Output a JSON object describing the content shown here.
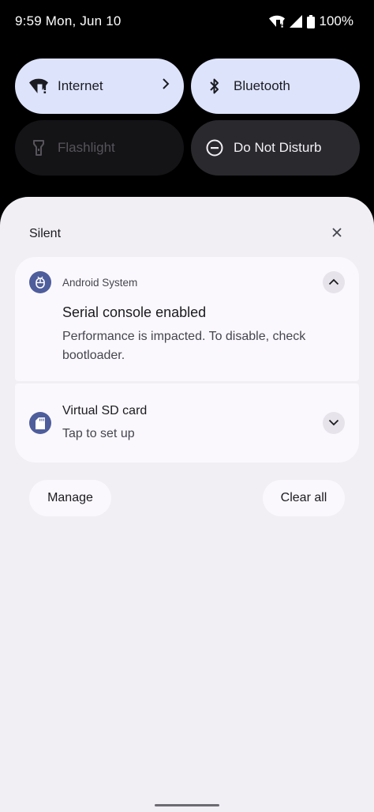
{
  "status_bar": {
    "time": "9:59 Mon, Jun 10",
    "battery": "100%"
  },
  "quick_settings": {
    "internet": {
      "label": "Internet",
      "icon": "wifi-alert-icon",
      "state": "on"
    },
    "bluetooth": {
      "label": "Bluetooth",
      "icon": "bluetooth-icon",
      "state": "on"
    },
    "flashlight": {
      "label": "Flashlight",
      "icon": "flashlight-icon",
      "state": "unavailable"
    },
    "dnd": {
      "label": "Do Not Disturb",
      "icon": "do-not-disturb-icon",
      "state": "off"
    }
  },
  "notifications": {
    "section_title": "Silent",
    "items": [
      {
        "app": "Android System",
        "title": "Serial console enabled",
        "text": "Performance is impacted. To disable, check bootloader.",
        "icon": "bug-icon",
        "expanded": true
      },
      {
        "title": "Virtual SD card",
        "text": "Tap to set up",
        "icon": "sd-card-icon",
        "expanded": false
      }
    ],
    "manage_label": "Manage",
    "clear_all_label": "Clear all"
  },
  "colors": {
    "tile_on": "#dde3fb",
    "tile_off": "#2a292d",
    "shade_bg": "#f1eff4",
    "card_bg": "#fbf8fd",
    "app_badge": "#4e5d9b"
  }
}
